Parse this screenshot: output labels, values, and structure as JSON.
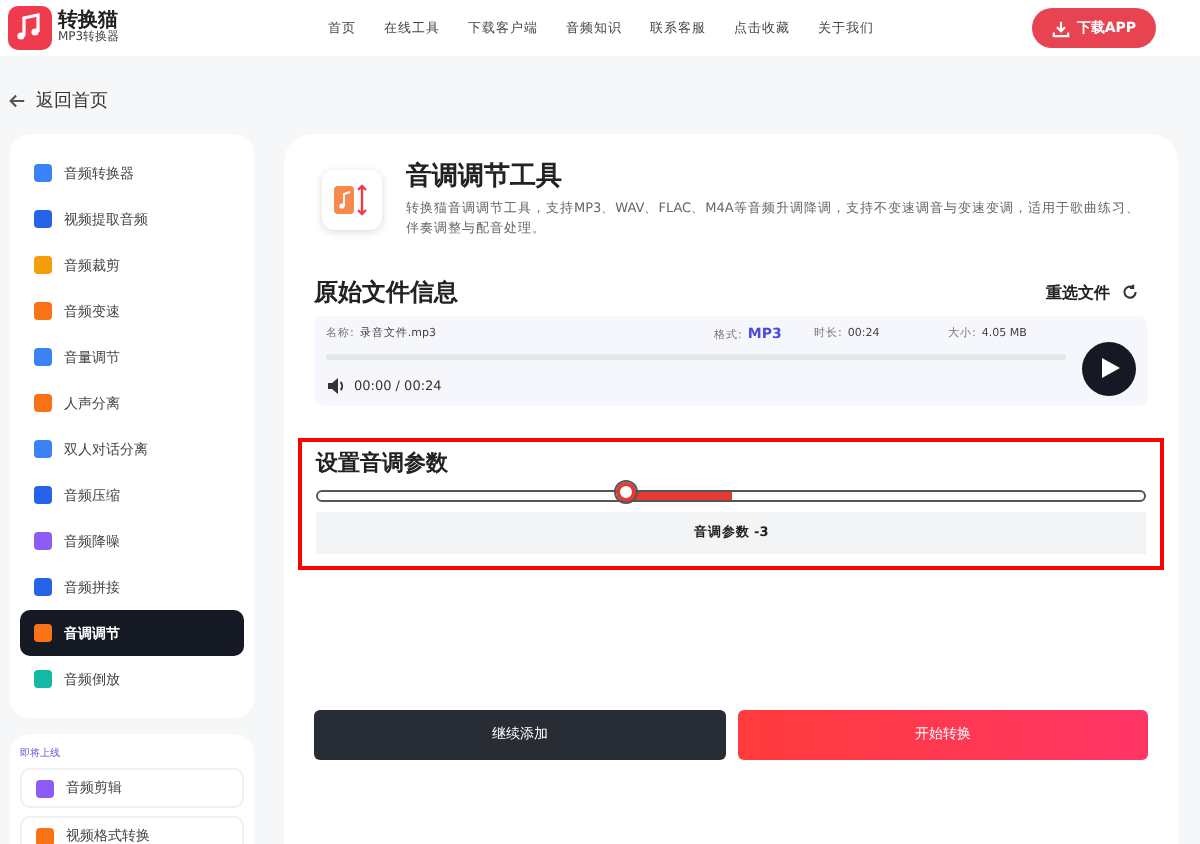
{
  "header": {
    "logo_name": "转换猫",
    "logo_sub": "MP3转换器",
    "nav": [
      {
        "label": "首页"
      },
      {
        "label": "在线工具"
      },
      {
        "label": "下载客户端"
      },
      {
        "label": "音频知识"
      },
      {
        "label": "联系客服"
      },
      {
        "label": "点击收藏"
      },
      {
        "label": "关于我们"
      }
    ],
    "download_button": "下载APP"
  },
  "back_link": "返回首页",
  "sidebar": {
    "items": [
      {
        "label": "音频转换器",
        "color": "#3b82f6",
        "selected": false
      },
      {
        "label": "视频提取音频",
        "color": "#2563eb",
        "selected": false
      },
      {
        "label": "音频裁剪",
        "color": "#f59e0b",
        "selected": false
      },
      {
        "label": "音频变速",
        "color": "#f97316",
        "selected": false
      },
      {
        "label": "音量调节",
        "color": "#3b82f6",
        "selected": false
      },
      {
        "label": "人声分离",
        "color": "#f97316",
        "selected": false
      },
      {
        "label": "双人对话分离",
        "color": "#3b82f6",
        "selected": false
      },
      {
        "label": "音频压缩",
        "color": "#2563eb",
        "selected": false
      },
      {
        "label": "音频降噪",
        "color": "#8b5cf6",
        "selected": false
      },
      {
        "label": "音频拼接",
        "color": "#2563eb",
        "selected": false
      },
      {
        "label": "音调调节",
        "color": "#f97316",
        "selected": true
      },
      {
        "label": "音频倒放",
        "color": "#14b8a6",
        "selected": false
      }
    ],
    "coming_soon": {
      "heading": "即将上线",
      "items": [
        {
          "label": "音频剪辑",
          "color": "#8b5cf6"
        },
        {
          "label": "视频格式转换",
          "color": "#f97316"
        }
      ]
    }
  },
  "tool": {
    "title": "音调调节工具",
    "description": "转换猫音调调节工具，支持MP3、WAV、FLAC、M4A等音频升调降调，支持不变速调音与变速变调，适用于歌曲练习、伴奏调整与配音处理。"
  },
  "file_info": {
    "heading": "原始文件信息",
    "reselect": "重选文件",
    "name_label": "名称:",
    "name": "录音文件.mp3",
    "format_label": "格式:",
    "format": "MP3",
    "duration_label": "时长:",
    "duration": "00:24",
    "size_label": "大小:",
    "size": "4.05 MB",
    "time": "00:00 / 00:24",
    "progress": {
      "level": 0
    }
  },
  "pitch": {
    "heading": "设置音调参数",
    "slider": {
      "level": 0.375
    },
    "value_text": "音调参数 -3"
  },
  "buttons": {
    "continue": "继续添加",
    "start": "开始转换"
  }
}
